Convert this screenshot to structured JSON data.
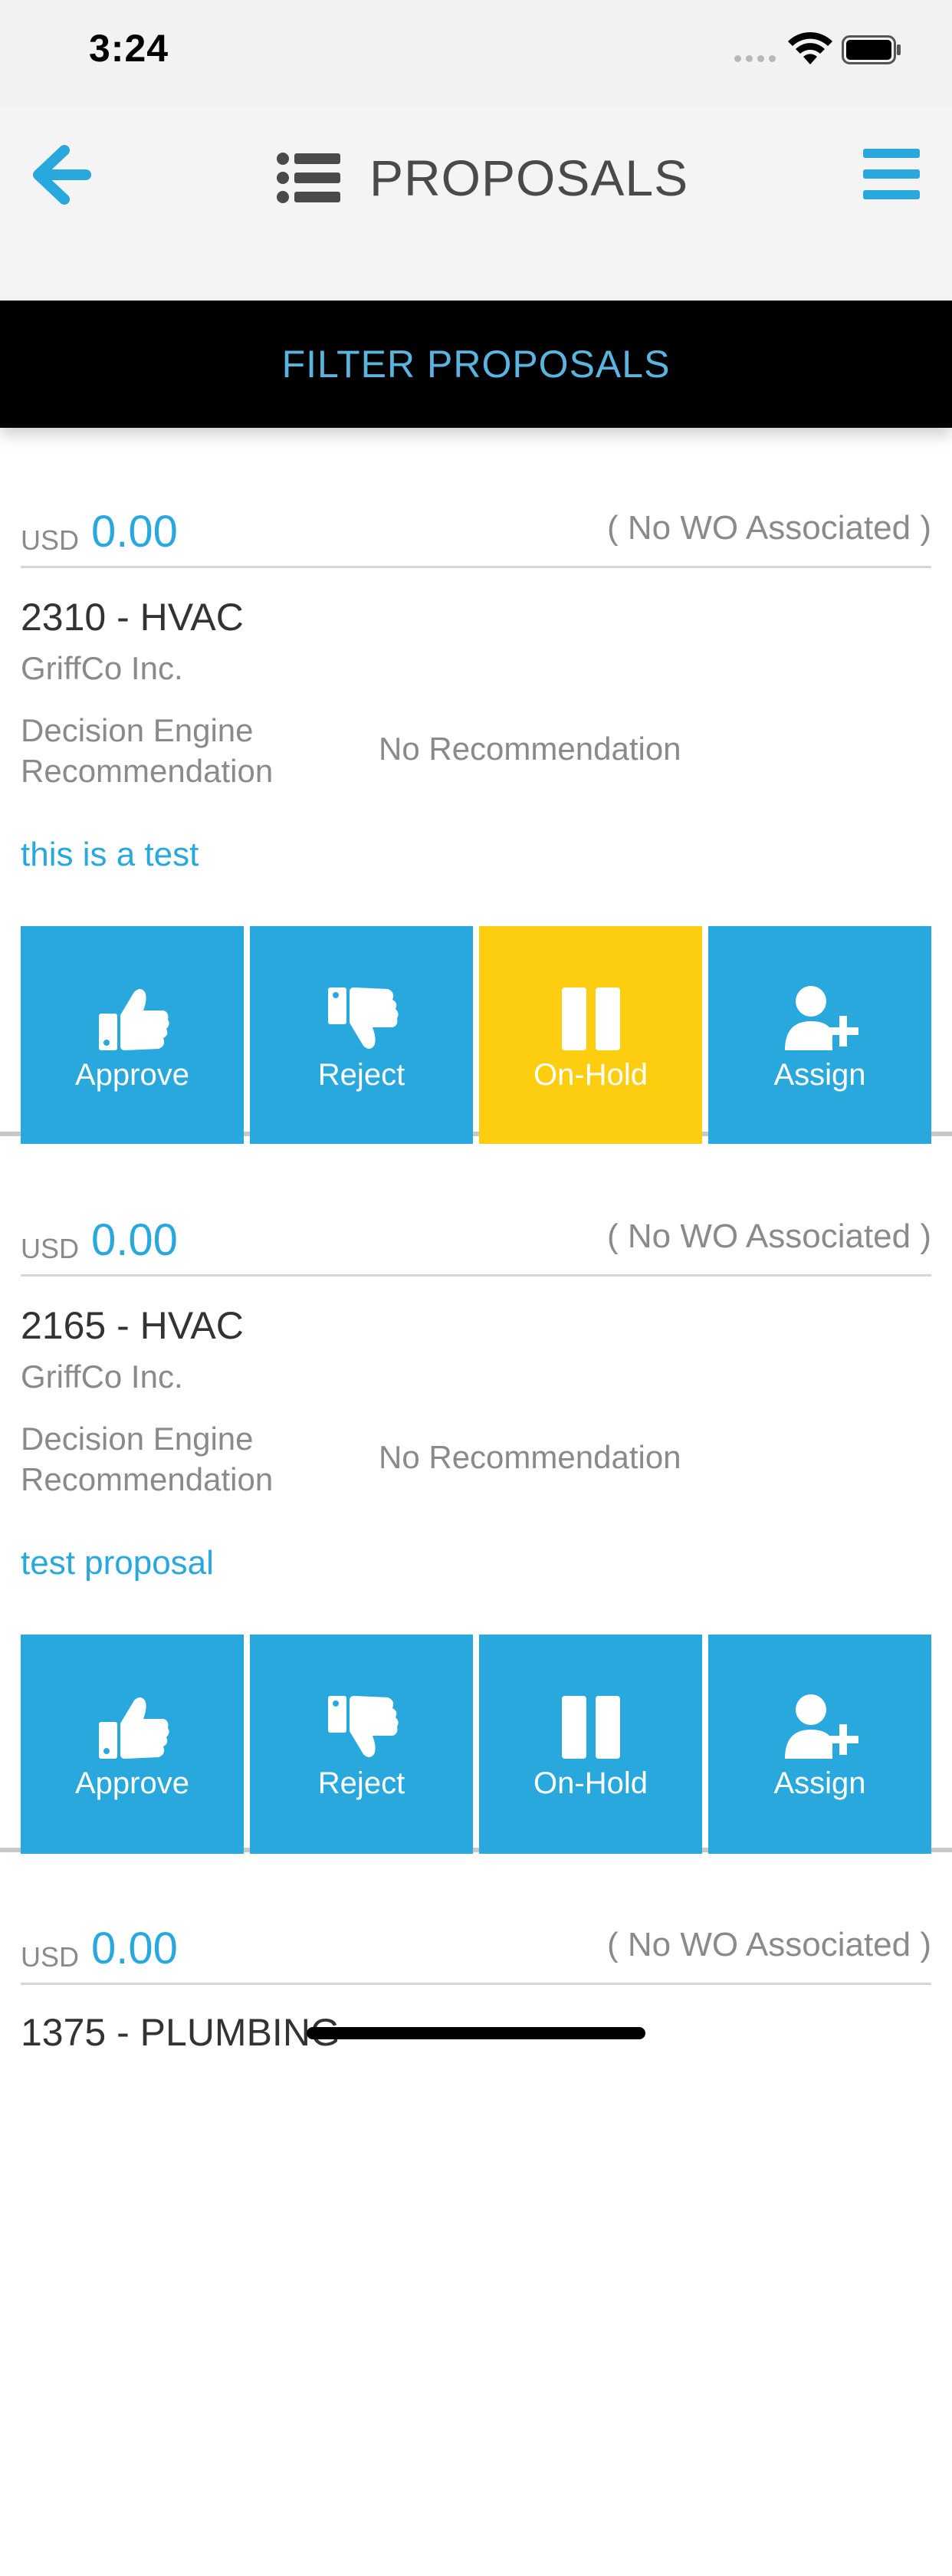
{
  "status_bar": {
    "time": "3:24"
  },
  "nav": {
    "title": "PROPOSALS",
    "back_icon": "arrow-left-icon",
    "list_icon": "list-icon",
    "menu_icon": "hamburger-menu-icon",
    "accent_color": "#29a8de"
  },
  "filter": {
    "label": "FILTER PROPOSALS"
  },
  "proposals": [
    {
      "currency": "USD",
      "amount": "0.00",
      "wo_status": "( No WO Associated )",
      "title": "2310 - HVAC",
      "vendor": "GriffCo Inc.",
      "rec_label": "Decision Engine Recommendation",
      "rec_value": "No Recommendation",
      "description": "this is a test",
      "actions": [
        {
          "label": "Approve",
          "icon": "thumbs-up-icon",
          "active": false
        },
        {
          "label": "Reject",
          "icon": "thumbs-down-icon",
          "active": false
        },
        {
          "label": "On-Hold",
          "icon": "pause-icon",
          "active": true
        },
        {
          "label": "Assign",
          "icon": "user-plus-icon",
          "active": false
        }
      ]
    },
    {
      "currency": "USD",
      "amount": "0.00",
      "wo_status": "( No WO Associated )",
      "title": "2165 - HVAC",
      "vendor": "GriffCo Inc.",
      "rec_label": "Decision Engine Recommendation",
      "rec_value": "No Recommendation",
      "description": "test proposal",
      "actions": [
        {
          "label": "Approve",
          "icon": "thumbs-up-icon",
          "active": false
        },
        {
          "label": "Reject",
          "icon": "thumbs-down-icon",
          "active": false
        },
        {
          "label": "On-Hold",
          "icon": "pause-icon",
          "active": false
        },
        {
          "label": "Assign",
          "icon": "user-plus-icon",
          "active": false
        }
      ]
    },
    {
      "currency": "USD",
      "amount": "0.00",
      "wo_status": "( No WO Associated )",
      "title": "1375 - PLUMBING"
    }
  ],
  "colors": {
    "primary": "#29a8de",
    "on_hold_active": "#fdcd10",
    "filter_bg": "#000000"
  }
}
